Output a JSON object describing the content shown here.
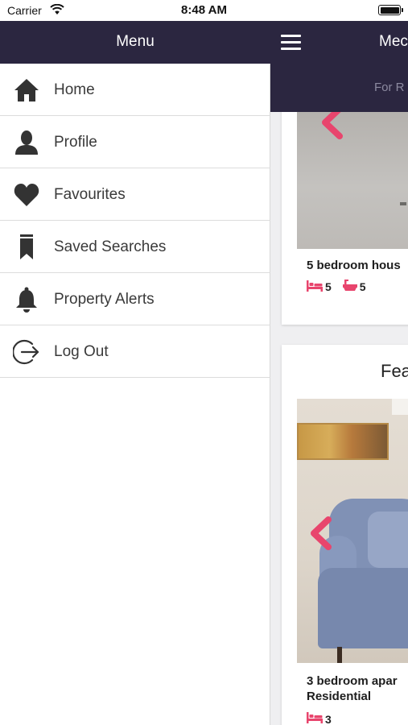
{
  "status_bar": {
    "carrier": "Carrier",
    "time": "8:48 AM"
  },
  "drawer": {
    "title": "Menu",
    "items": [
      {
        "label": "Home",
        "icon": "home-icon"
      },
      {
        "label": "Profile",
        "icon": "person-icon"
      },
      {
        "label": "Favourites",
        "icon": "heart-icon"
      },
      {
        "label": "Saved Searches",
        "icon": "bookmark-icon"
      },
      {
        "label": "Property Alerts",
        "icon": "bell-icon"
      },
      {
        "label": "Log Out",
        "icon": "logout-icon"
      }
    ]
  },
  "main": {
    "title_partial": "Meс",
    "tab_partial": "For R",
    "featured_label_partial": "Fea",
    "cards": [
      {
        "title": "5 bedroom hous",
        "beds": "5",
        "baths": "5"
      },
      {
        "title": "3 bedroom apar Residential",
        "beds": "3"
      }
    ]
  },
  "colors": {
    "header_bg": "#2b2640",
    "accent_pink": "#e8456d",
    "icon_dark": "#333333"
  }
}
